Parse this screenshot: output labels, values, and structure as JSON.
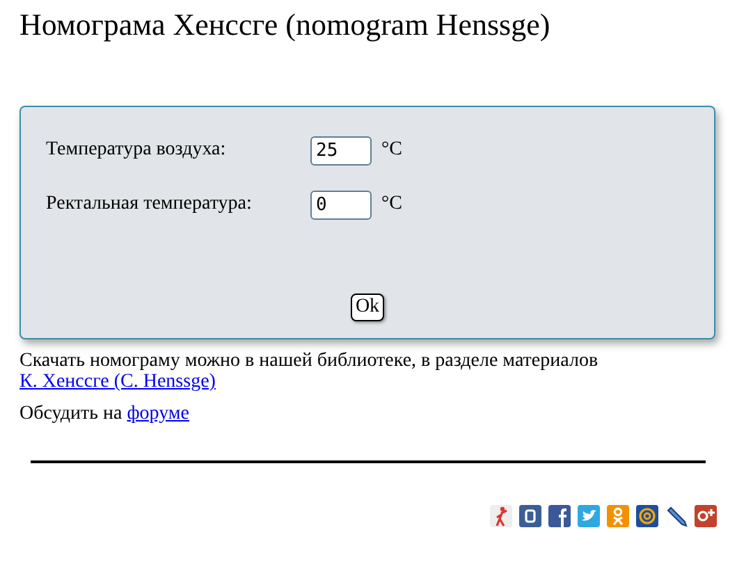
{
  "title": "Номограма Хенссге (nomogram Henssge)",
  "form": {
    "fields": [
      {
        "label": "Температура воздуха:",
        "value": "25",
        "unit": "°C"
      },
      {
        "label": "Ректальная температура:",
        "value": "0",
        "unit": "°C"
      }
    ],
    "button": "Ok"
  },
  "download": {
    "text": "Скачать номограму можно в нашей библиотеке, в разделе материалов",
    "link": "К. Хенссге (С. Henssge)"
  },
  "discuss": {
    "text": "Обсудить на",
    "link": "форуме"
  }
}
